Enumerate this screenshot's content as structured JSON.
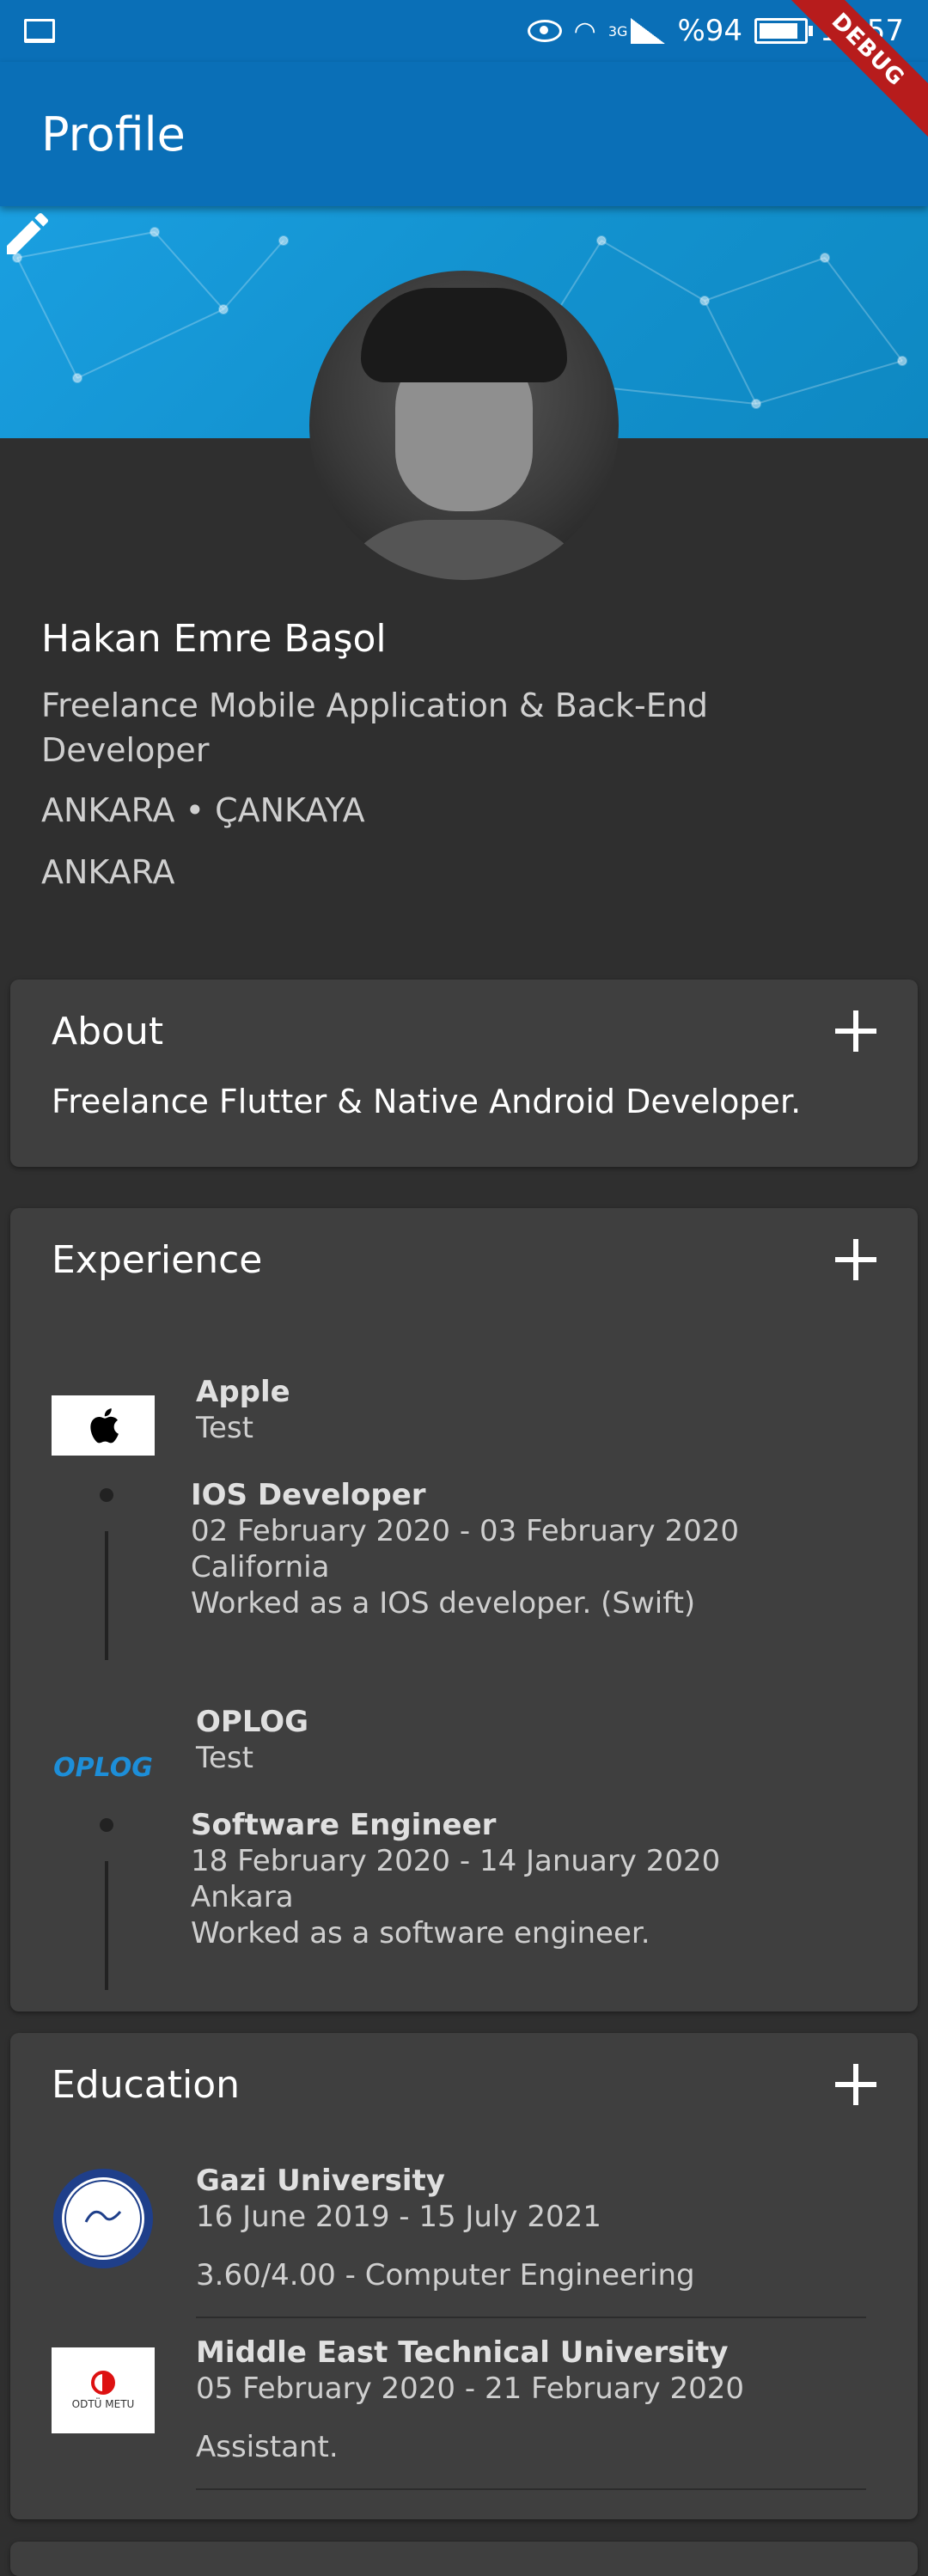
{
  "status": {
    "battery": "%94",
    "time": "16:57",
    "network": "3G"
  },
  "appbar": {
    "title": "Profile"
  },
  "debug": "DEBUG",
  "profile": {
    "name": "Hakan Emre Başol",
    "headline": "Freelance Mobile Application & Back-End Developer",
    "location": "ANKARA • ÇANKAYA",
    "city": "ANKARA"
  },
  "about": {
    "title": "About",
    "text": "Freelance Flutter & Native Android Developer."
  },
  "experience": {
    "title": "Experience",
    "items": [
      {
        "company": "Apple",
        "subtitle": "Test",
        "role": "IOS Developer",
        "dates": "02 February 2020 - 03 February 2020",
        "place": "California",
        "desc": "Worked as a IOS developer. (Swift)"
      },
      {
        "company": "OPLOG",
        "subtitle": "Test",
        "role": "Software Engineer",
        "dates": "18 February 2020 - 14 January 2020",
        "place": "Ankara",
        "desc": "Worked as a software engineer."
      }
    ]
  },
  "education": {
    "title": "Education",
    "items": [
      {
        "school": "Gazi University",
        "dates": "16 June 2019 - 15 July 2021",
        "detail": "3.60/4.00 - Computer Engineering"
      },
      {
        "school": "Middle East Technical University",
        "dates": "05 February 2020 - 21 February 2020",
        "detail": "Assistant."
      }
    ]
  },
  "logos": {
    "oplog_text": "OPLOG",
    "metu_text": "ODTÜ METU"
  },
  "colors": {
    "primary": "#0a6fb7",
    "background": "#2f2f2f",
    "card": "#3f3f3f",
    "oplog_blue": "#1d8ed8",
    "debug_red": "#b71c1c"
  }
}
